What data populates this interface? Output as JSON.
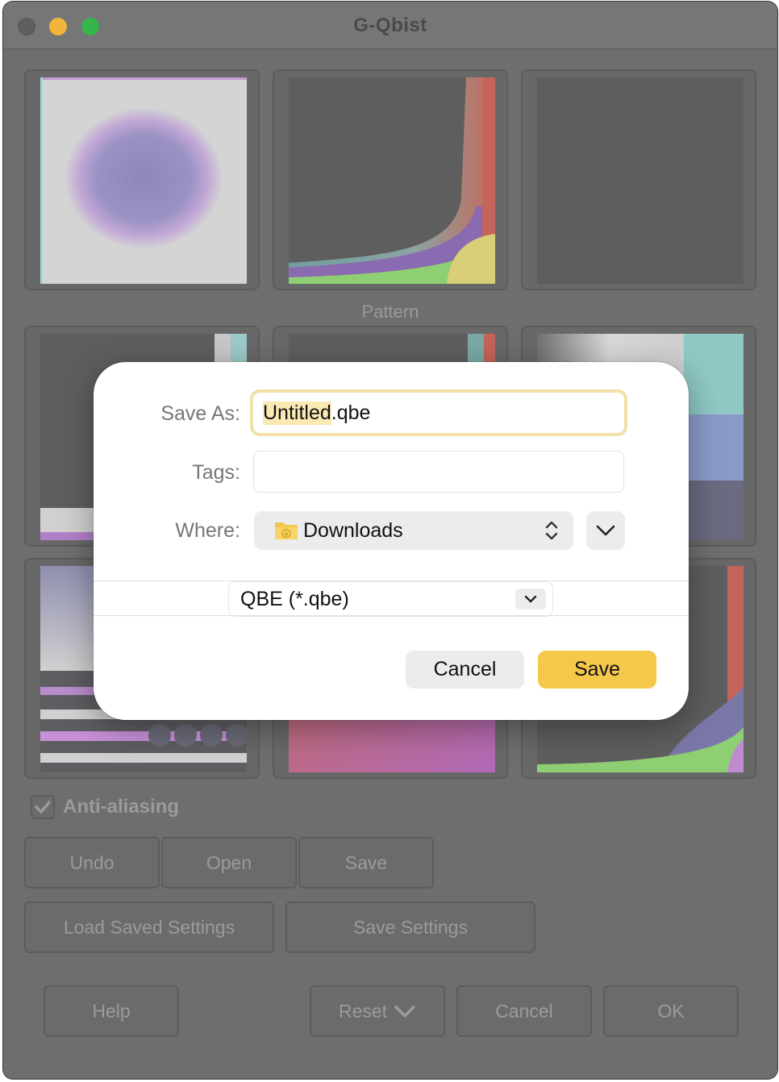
{
  "window": {
    "title": "G-Qbist"
  },
  "section": {
    "label": "Pattern"
  },
  "options": {
    "antialias_label": "Anti-aliasing",
    "antialias_checked": true
  },
  "buttons": {
    "undo": "Undo",
    "open": "Open",
    "save": "Save",
    "load_settings": "Load Saved Settings",
    "save_settings": "Save Settings",
    "help": "Help",
    "reset": "Reset",
    "cancel": "Cancel",
    "ok": "OK"
  },
  "save_dialog": {
    "save_as_label": "Save As:",
    "filename_base": "Untitled",
    "filename_ext": ".qbe",
    "tags_label": "Tags:",
    "tags_value": "",
    "where_label": "Where:",
    "where_value": "Downloads",
    "format_value": "QBE (*.qbe)",
    "cancel_label": "Cancel",
    "save_label": "Save",
    "accent_color": "#f5c84b"
  },
  "icons": {
    "folder": "downloads-folder-icon",
    "updown": "updown-chevron-icon",
    "expand": "chevron-down-icon",
    "check": "checkmark-icon"
  }
}
